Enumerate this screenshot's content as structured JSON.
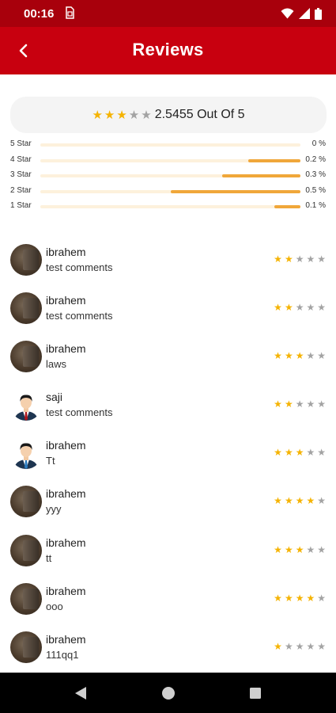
{
  "status_bar": {
    "time": "00:16"
  },
  "header": {
    "title": "Reviews"
  },
  "summary": {
    "stars_filled": 2.5455,
    "rating_text": "2.5455 Out Of 5"
  },
  "breakdown": [
    {
      "label": "5 Star",
      "percent_text": "0 %",
      "share": 0.0
    },
    {
      "label": "4 Star",
      "percent_text": "0.2 %",
      "share": 0.2
    },
    {
      "label": "3 Star",
      "percent_text": "0.3 %",
      "share": 0.3
    },
    {
      "label": "2 Star",
      "percent_text": "0.5 %",
      "share": 0.5
    },
    {
      "label": "1 Star",
      "percent_text": "0.1 %",
      "share": 0.1
    }
  ],
  "reviews": [
    {
      "name": "ibrahem",
      "comment": "test comments",
      "stars": 2,
      "avatar": "photo"
    },
    {
      "name": "ibrahem",
      "comment": "test comments",
      "stars": 2,
      "avatar": "photo"
    },
    {
      "name": "ibrahem",
      "comment": "laws",
      "stars": 3,
      "avatar": "photo"
    },
    {
      "name": "saji",
      "comment": "test comments",
      "stars": 2,
      "avatar": "person-suit"
    },
    {
      "name": "ibrahem",
      "comment": "Tt",
      "stars": 3,
      "avatar": "person-tie"
    },
    {
      "name": "ibrahem",
      "comment": "yyy",
      "stars": 4,
      "avatar": "photo"
    },
    {
      "name": "ibrahem",
      "comment": "tt",
      "stars": 3,
      "avatar": "photo"
    },
    {
      "name": "ibrahem",
      "comment": "ooo",
      "stars": 4,
      "avatar": "photo"
    },
    {
      "name": "ibrahem",
      "comment": "111qq1",
      "stars": 1,
      "avatar": "photo"
    }
  ],
  "colors": {
    "status_bar": "#a8000c",
    "app_bar": "#c8000f",
    "star_on": "#f5b301",
    "star_off": "#a3a3a3",
    "bar_fill": "#f0a73a"
  },
  "icons": {
    "back": "back-arrow-icon",
    "sim": "sim-card-icon",
    "wifi": "wifi-icon",
    "signal": "signal-icon",
    "battery": "battery-icon"
  }
}
